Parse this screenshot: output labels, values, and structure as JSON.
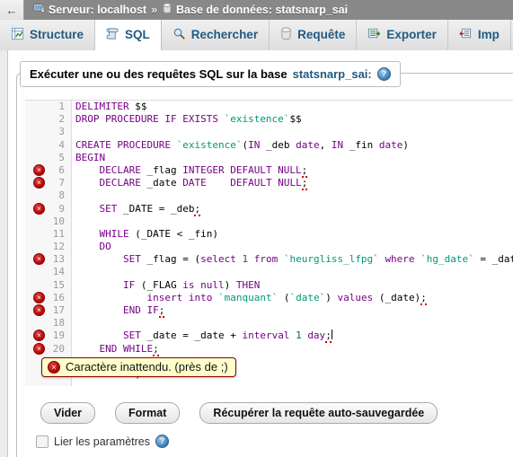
{
  "topbar": {
    "back_label": "←",
    "server_icon": "server-icon",
    "server_label": "Serveur: localhost",
    "separator": "»",
    "db_icon": "database-icon",
    "db_label": "Base de données: statsnarp_sai"
  },
  "tabs": [
    {
      "icon": "structure-icon",
      "label": "Structure",
      "active": false
    },
    {
      "icon": "sql-icon",
      "label": "SQL",
      "active": true
    },
    {
      "icon": "search-icon",
      "label": "Rechercher",
      "active": false
    },
    {
      "icon": "query-icon",
      "label": "Requête",
      "active": false
    },
    {
      "icon": "export-icon",
      "label": "Exporter",
      "active": false
    },
    {
      "icon": "import-icon",
      "label": "Imp",
      "active": false
    }
  ],
  "legend": {
    "text_before": "Exécuter une ou des requêtes SQL sur la base",
    "db_name": "statsnarp_sai:",
    "help_icon": "help-icon",
    "help_glyph": "?"
  },
  "editor": {
    "lines": [
      {
        "n": "1",
        "error": false,
        "html": "<span class=\"kw\">DELIMITER</span> $$"
      },
      {
        "n": "2",
        "error": false,
        "html": "<span class=\"kw\">DROP PROCEDURE IF EXISTS</span> <span class=\"id\">`existence`</span>$$"
      },
      {
        "n": "3",
        "error": false,
        "html": ""
      },
      {
        "n": "4",
        "error": false,
        "html": "<span class=\"kw\">CREATE PROCEDURE</span> <span class=\"id\">`existence`</span>(<span class=\"kw\">IN</span> _deb <span class=\"kw\">date</span>, <span class=\"kw\">IN</span> _fin <span class=\"kw\">date</span>)"
      },
      {
        "n": "5",
        "error": false,
        "html": "<span class=\"kw\">BEGIN</span>"
      },
      {
        "n": "6",
        "error": true,
        "html": "    <span class=\"kw\">DECLARE</span> _flag <span class=\"kw\">INTEGER DEFAULT NULL</span><span class=\"err\">;</span>"
      },
      {
        "n": "7",
        "error": true,
        "html": "    <span class=\"kw\">DECLARE</span> _date <span class=\"kw\">DATE</span>    <span class=\"kw\">DEFAULT NULL</span><span class=\"err\">;</span>"
      },
      {
        "n": "8",
        "error": false,
        "html": ""
      },
      {
        "n": "9",
        "error": true,
        "html": "    <span class=\"kw\">SET</span> _DATE = _deb<span class=\"err\">;</span>"
      },
      {
        "n": "10",
        "error": false,
        "html": ""
      },
      {
        "n": "11",
        "error": false,
        "html": "    <span class=\"kw\">WHILE</span> (_DATE &lt; _fin)"
      },
      {
        "n": "12",
        "error": false,
        "html": "    <span class=\"kw\">DO</span>"
      },
      {
        "n": "13",
        "error": true,
        "html": "        <span class=\"kw\">SET</span> _flag = (<span class=\"kw\">select</span> <span class=\"num\">1</span> <span class=\"kw\">from</span> <span class=\"id\">`heurgliss_lfpg`</span> <span class=\"kw\">where</span> <span class=\"id\">`hg_date`</span> = _date)<span class=\"err\">;</span>"
      },
      {
        "n": "14",
        "error": false,
        "html": ""
      },
      {
        "n": "15",
        "error": false,
        "html": "        <span class=\"kw\">IF</span> (_FLAG <span class=\"kw\">is null</span>) <span class=\"kw\">THEN</span>"
      },
      {
        "n": "16",
        "error": true,
        "html": "            <span class=\"kw\">insert into</span> <span class=\"id\">`manquant`</span> (<span class=\"id\">`date`</span>) <span class=\"kw\">values</span> (_date)<span class=\"err\">;</span>"
      },
      {
        "n": "17",
        "error": true,
        "html": "        <span class=\"kw\">END IF</span><span class=\"err\">;</span>"
      },
      {
        "n": "18",
        "error": false,
        "html": ""
      },
      {
        "n": "19",
        "error": true,
        "html": "        <span class=\"kw\">SET</span> _date = _date + <span class=\"kw\">interval</span> <span class=\"num\">1</span> <span class=\"kw\">day</span><span class=\"err\">;</span><span class=\"caret\"></span>"
      },
      {
        "n": "20",
        "error": true,
        "html": "    <span class=\"kw\">END WHILE</span><span class=\"err\">;</span>"
      },
      {
        "n": "21",
        "error": false,
        "html": "<span class=\"kw\">END</span> $$"
      },
      {
        "n": "22",
        "error": false,
        "html": "<span class=\"kw\">DELIMITER</span> ;"
      }
    ],
    "error_marker_glyph": "×"
  },
  "tooltip": {
    "icon": "error-icon",
    "glyph": "×",
    "message": "Caractère inattendu. (près de ;)"
  },
  "buttons": [
    {
      "label": "Vider",
      "name": "clear-button"
    },
    {
      "label": "Format",
      "name": "format-button"
    },
    {
      "label": "Récupérer la requête auto-sauvegardée",
      "name": "restore-autosaved-query-button"
    }
  ],
  "parameters": {
    "checkbox_checked": false,
    "label": "Lier les paramètres",
    "help_glyph": "?"
  },
  "colors": {
    "topbar_bg": "#888888",
    "tab_text": "#235a81",
    "error_red": "#b00000",
    "tooltip_bg": "#ffffcc",
    "keyword": "#770088",
    "identifier": "#009977"
  }
}
